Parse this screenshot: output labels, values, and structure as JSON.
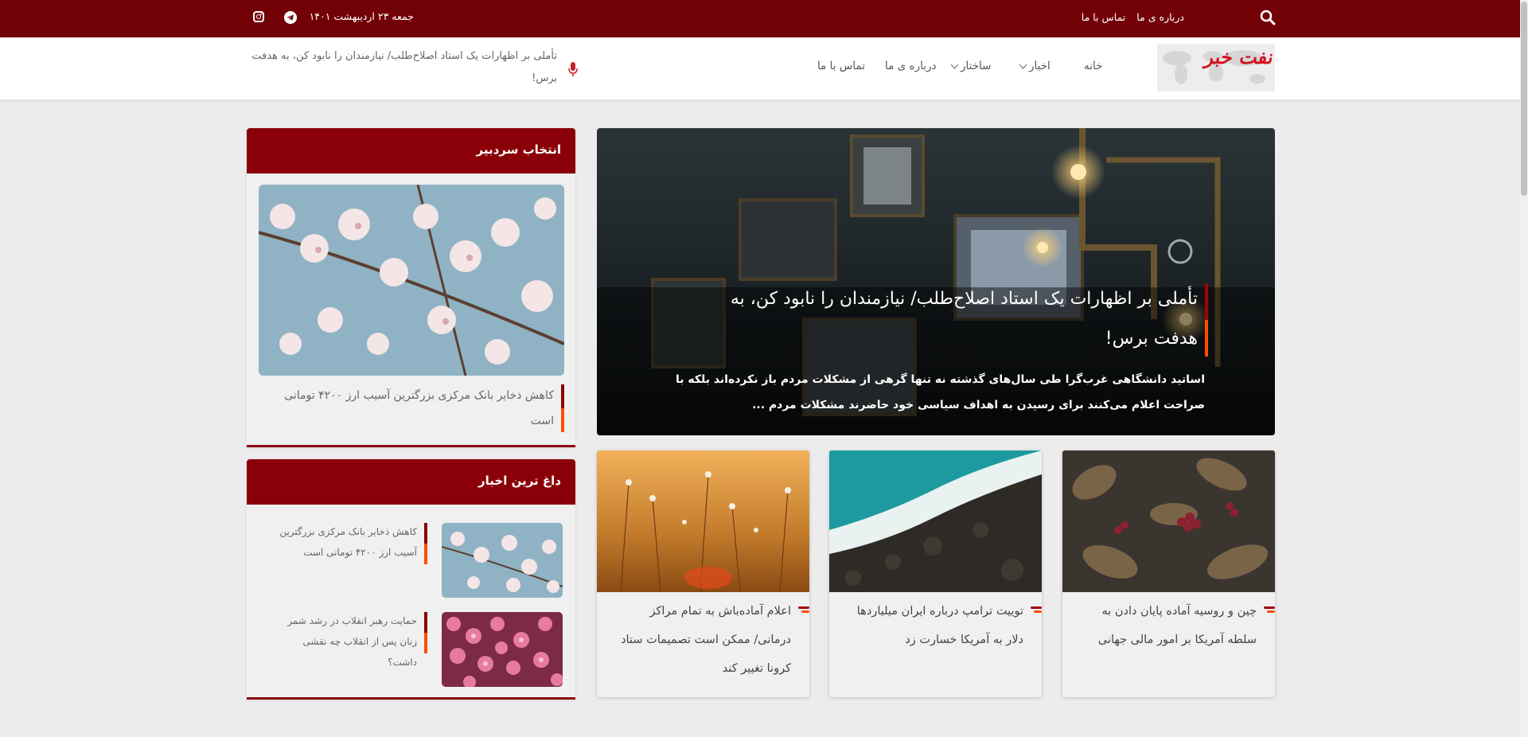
{
  "topbar": {
    "links": [
      "درباره ی ما",
      "تماس با ما"
    ],
    "date": "جمعه ۲۳ اردیبهشت ۱۴۰۱",
    "social": [
      "telegram-icon",
      "instagram-icon"
    ]
  },
  "header": {
    "logo_text": "نفت خبر",
    "nav": [
      "خانه",
      "اخبار",
      "ساختار",
      "درباره ی ما",
      "تماس با ما"
    ],
    "ticker": "تأملی بر اظهارات یک استاد اصلاح‌طلب/ نیازمندان را نابود کن، به هدفت برس!"
  },
  "hero": {
    "title": "تأملی بر اظهارات یک استاد اصلاح‌طلب/ نیازمندان را نابود کن، به هدفت برس!",
    "excerpt": "اساتید دانشگاهی غرب‌گرا طی سال‌های گذشته نه تنها گرهی از مشکلات مردم باز نکرده‌اند بلکه با صراحت اعلام می‌کنند برای رسیدن به اهداف سیاسی خود حاضرند مشکلات مردم ..."
  },
  "cards": [
    {
      "title": "چین و روسیه آماده پایان دادن به سلطه آمریکا بر امور مالی جهانی"
    },
    {
      "title": "توییت ترامپ درباره ایران میلیاردها دلار به آمریکا خسارت زد"
    },
    {
      "title": "اعلام آماده‌باش به تمام مراکز درمانی/ ممکن است تصمیمات ستاد کرونا تغییر کند"
    }
  ],
  "editor_pick": {
    "heading": "انتخاب سردبیر",
    "title": "کاهش ذخایر بانک مرکزی بزرگترین آسیب ارز ۴۲۰۰ تومانی است"
  },
  "hot_news": {
    "heading": "داغ ترین اخبار",
    "items": [
      {
        "title": "کاهش ذخایر بانک مرکزی بزرگترین آسیب ارز ۴۲۰۰ تومانی است"
      },
      {
        "title": "حمایت رهبر انقلاب در رشد شمر زنان پس از انقلاب چه نقشی داشت؟"
      }
    ]
  },
  "colors": {
    "brand": "#720007",
    "accent": "#ff4d00",
    "widget_head": "#8b0008"
  }
}
